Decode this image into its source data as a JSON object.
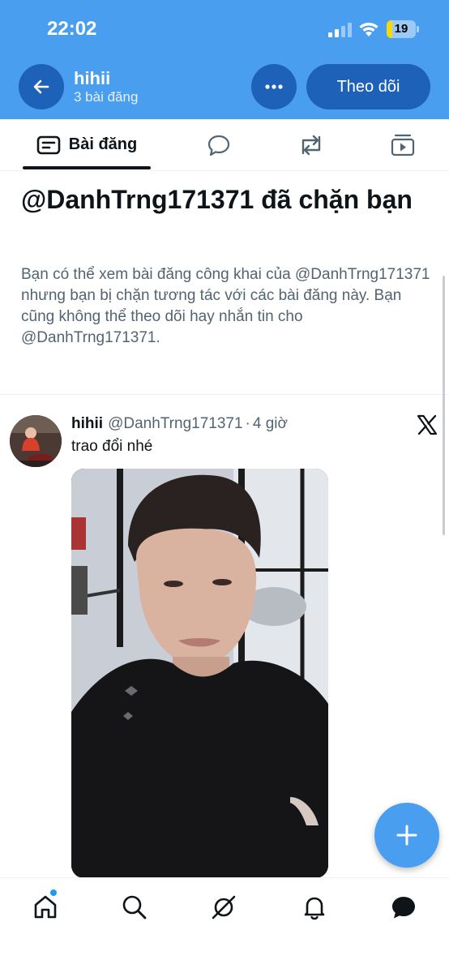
{
  "status_bar": {
    "time": "22:02",
    "battery_level": "19",
    "battery_fraction": 0.19,
    "battery_color": "#f5d90a"
  },
  "header": {
    "background": "#4a9ef0",
    "button_color": "#1d62b8",
    "profile_name": "hihii",
    "post_count": "3 bài đăng",
    "follow_label": "Theo dõi",
    "back_icon": "arrow-left-icon",
    "more_icon": "more-horizontal-icon"
  },
  "tabs": [
    {
      "label": "Bài đăng",
      "icon": "posts-icon",
      "active": true
    },
    {
      "label": "",
      "icon": "reply-bubble-icon",
      "active": false
    },
    {
      "label": "",
      "icon": "repost-icon",
      "active": false
    },
    {
      "label": "",
      "icon": "media-play-icon",
      "active": false
    }
  ],
  "blocked_notice": {
    "title": "@DanhTrng171371 đã chặn bạn",
    "description": "Bạn có thể xem bài đăng công khai của @DanhTrng171371 nhưng bạn bị chặn tương tác với các bài đăng này. Bạn cũng không thể theo dõi hay nhắn tin cho @DanhTrng171371."
  },
  "post": {
    "author_name": "hihii",
    "handle": "@DanhTrng171371",
    "separator": "·",
    "time": "4 giờ",
    "text": "trao đổi nhé",
    "source_icon": "x-logo-icon"
  },
  "fab": {
    "icon": "plus-icon"
  },
  "bottom_nav": [
    {
      "icon": "home-icon",
      "active": true
    },
    {
      "icon": "search-icon",
      "active": false
    },
    {
      "icon": "grok-icon",
      "active": false
    },
    {
      "icon": "bell-icon",
      "active": false
    },
    {
      "icon": "messages-icon",
      "active": false
    }
  ]
}
